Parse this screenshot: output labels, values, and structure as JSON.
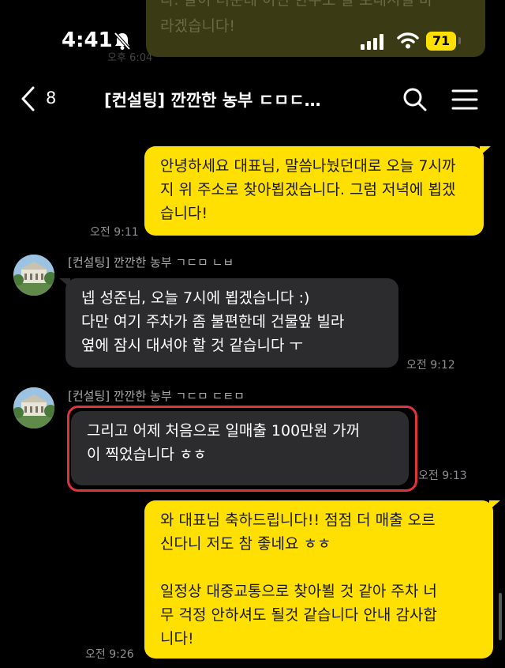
{
  "previous_message": {
    "text": "다. 날이 더운데 이번 한주도 잘 보내시길 바\n라겠습니다!",
    "time": "오후 6:04"
  },
  "status_bar": {
    "time": "4:41",
    "battery": "71"
  },
  "header": {
    "back_count": "8",
    "title": "[컨설팅] 깐깐한 농부 ㄷㅁㄷ…"
  },
  "messages": [
    {
      "direction": "out",
      "text": "안녕하세요 대표님, 말씀나눴던대로 오늘 7시까지 위 주소로 찾아뵙겠습니다. 그럼 저녁에 뵙겠습니다!",
      "time": "오전 9:11"
    },
    {
      "direction": "in",
      "sender": "[컨설팅] 깐깐한 농부 ㄱㄷㅁ ㄴㅂ",
      "text": "넵 성준님, 오늘 7시에 뵙겠습니다 :)\n다만 여기 주차가 좀 불편한데 건물앞 빌라\n옆에 잠시 대셔야 할 것 같습니다 ㅜ",
      "time": "오전 9:12"
    },
    {
      "direction": "in",
      "sender": "[컨설팅] 깐깐한 농부 ㄱㄷㅁ ㄷㅌㅁ",
      "text": "그리고 어제 처음으로 일매출 100만원 가꺼\n이 찍었습니다 ㅎㅎ",
      "time": "오전 9:13"
    },
    {
      "direction": "out",
      "text": "와 대표님 축하드립니다!! 점점 더 매출 오르\n신다니 저도 참 좋네요 ㅎㅎ\n\n일정상 대중교통으로 찾아뵐 것 같아 주차 너\n무 걱정 안하셔도 될것 같습니다 안내 감사합\n니다!",
      "time": "오전 9:26"
    }
  ],
  "colors": {
    "outgoing": "#ffe000",
    "incoming": "#2c2c2e",
    "highlight": "#e0343c",
    "background": "#000000"
  }
}
